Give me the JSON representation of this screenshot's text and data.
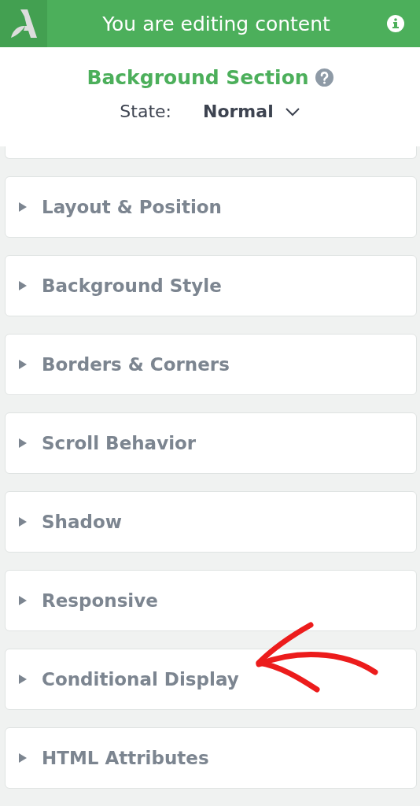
{
  "header": {
    "title": "You are editing content"
  },
  "element": {
    "title": "Background Section",
    "state_label": "State:",
    "state_value": "Normal"
  },
  "sections": [
    {
      "label": "Layout & Position",
      "expanded": false
    },
    {
      "label": "Background Style",
      "expanded": false
    },
    {
      "label": "Borders & Corners",
      "expanded": false
    },
    {
      "label": "Scroll Behavior",
      "expanded": false
    },
    {
      "label": "Shadow",
      "expanded": false
    },
    {
      "label": "Responsive",
      "expanded": false
    },
    {
      "label": "Conditional Display",
      "expanded": false
    },
    {
      "label": "HTML Attributes",
      "expanded": false
    }
  ]
}
